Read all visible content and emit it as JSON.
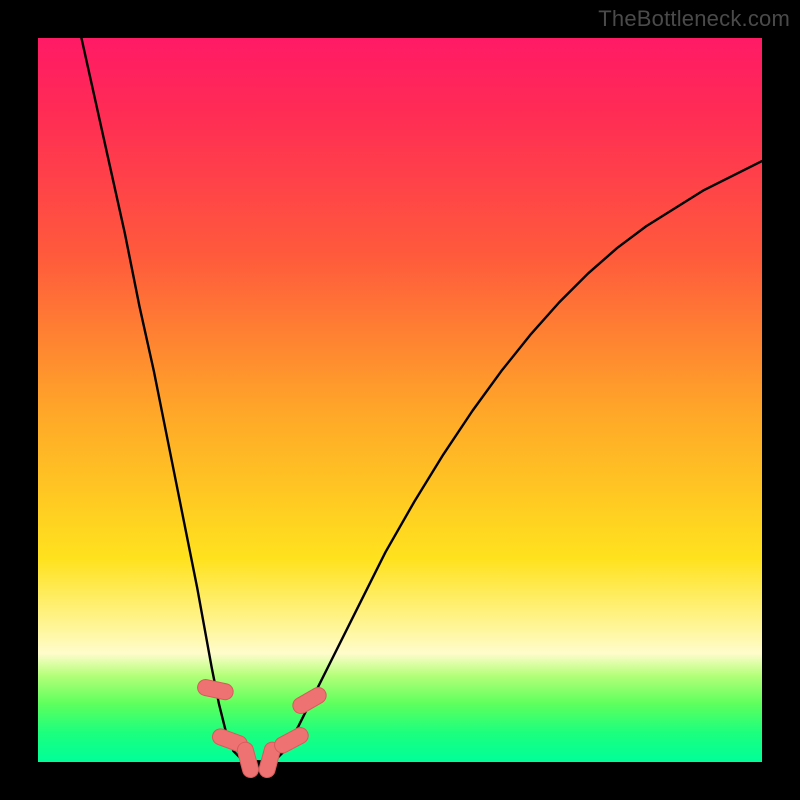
{
  "attribution": "TheBottleneck.com",
  "colors": {
    "frame": "#000000",
    "gradient_top": "#ff1a66",
    "gradient_bottom": "#00ff99",
    "curve": "#000000",
    "marker_fill": "#ef7272",
    "marker_stroke": "#d85a5a"
  },
  "chart_data": {
    "type": "line",
    "title": "",
    "xlabel": "",
    "ylabel": "",
    "xlim": [
      0,
      100
    ],
    "ylim": [
      0,
      100
    ],
    "series": [
      {
        "name": "left-branch",
        "x": [
          6.0,
          8.0,
          10.0,
          12.0,
          14.0,
          16.0,
          18.0,
          20.0,
          22.0,
          24.0,
          25.0,
          26.0,
          27.0,
          28.0
        ],
        "y": [
          100.0,
          91.0,
          82.0,
          73.0,
          63.0,
          54.0,
          44.0,
          34.0,
          24.0,
          13.0,
          8.0,
          4.0,
          1.5,
          0.5
        ]
      },
      {
        "name": "flat-bottom",
        "x": [
          28.0,
          29.0,
          30.0,
          31.0,
          32.0,
          33.0
        ],
        "y": [
          0.5,
          0.2,
          0.1,
          0.1,
          0.2,
          0.5
        ]
      },
      {
        "name": "right-branch",
        "x": [
          33.0,
          34.0,
          36.0,
          38.0,
          40.0,
          44.0,
          48.0,
          52.0,
          56.0,
          60.0,
          64.0,
          68.0,
          72.0,
          76.0,
          80.0,
          84.0,
          88.0,
          92.0,
          96.0,
          100.0
        ],
        "y": [
          0.5,
          1.5,
          5.0,
          9.0,
          13.0,
          21.0,
          29.0,
          36.0,
          42.5,
          48.5,
          54.0,
          59.0,
          63.5,
          67.5,
          71.0,
          74.0,
          76.5,
          79.0,
          81.0,
          83.0
        ]
      }
    ],
    "markers": [
      {
        "x": 24.5,
        "y": 10.0,
        "angle": -78
      },
      {
        "x": 26.5,
        "y": 3.0,
        "angle": -70
      },
      {
        "x": 29.0,
        "y": 0.3,
        "angle": -15
      },
      {
        "x": 32.0,
        "y": 0.3,
        "angle": 15
      },
      {
        "x": 35.0,
        "y": 3.0,
        "angle": 62
      },
      {
        "x": 37.5,
        "y": 8.5,
        "angle": 60
      }
    ]
  }
}
